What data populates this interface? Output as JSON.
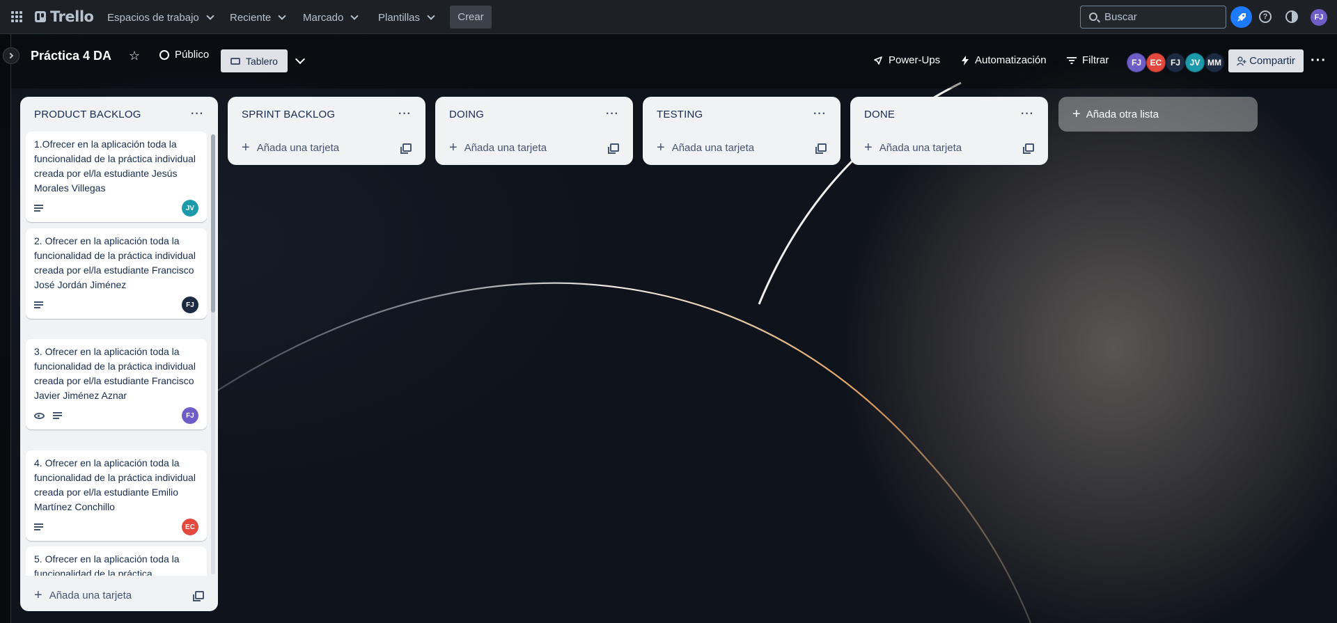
{
  "app": {
    "name": "Trello"
  },
  "nav": {
    "workspaces": "Espacios de trabajo",
    "recent": "Reciente",
    "starred": "Marcado",
    "templates": "Plantillas",
    "create": "Crear",
    "search_placeholder": "Buscar",
    "user_initials": "FJ"
  },
  "board": {
    "title": "Práctica 4 DA",
    "visibility": "Público",
    "view": "Tablero",
    "powerups": "Power-Ups",
    "automation": "Automatización",
    "filter": "Filtrar",
    "share": "Compartir",
    "members": [
      {
        "initials": "FJ",
        "color": "#6e5dc6"
      },
      {
        "initials": "EC",
        "color": "#e2483d"
      },
      {
        "initials": "FJ",
        "color": "#1c2b41"
      },
      {
        "initials": "JV",
        "color": "#1d9aaa"
      },
      {
        "initials": "MM",
        "color": "#1c2b41"
      }
    ]
  },
  "lists": [
    {
      "title": "PRODUCT BACKLOG",
      "add_card": "Añada una tarjeta",
      "cards": [
        {
          "text": "1.Ofrecer en la aplicación toda la funcionalidad de la práctica individual creada por el/la estudiante Jesús Morales Villegas",
          "member": "JV",
          "member_color": "#1d9aaa",
          "watch": false
        },
        {
          "text": "2. Ofrecer en la aplicación toda la funcionalidad de la práctica individual creada por el/la estudiante Francisco José Jordán Jiménez",
          "member": "FJ",
          "member_color": "#1c2b41",
          "watch": false
        },
        {
          "text": "3. Ofrecer en la aplicación toda la funcionalidad de la práctica individual creada por el/la estudiante Francisco Javier Jiménez Aznar",
          "member": "FJ",
          "member_color": "#6e5dc6",
          "watch": true
        },
        {
          "text": "4. Ofrecer en la aplicación toda la funcionalidad de la práctica individual creada por el/la estudiante Emilio Martínez Conchillo",
          "member": "EC",
          "member_color": "#e2483d",
          "watch": false
        },
        {
          "text": "5. Ofrecer en la aplicación toda la funcionalidad de la práctica",
          "member": "",
          "member_color": "",
          "watch": false
        }
      ]
    },
    {
      "title": "SPRINT BACKLOG",
      "add_card": "Añada una tarjeta",
      "cards": []
    },
    {
      "title": "DOING",
      "add_card": "Añada una tarjeta",
      "cards": []
    },
    {
      "title": "TESTING",
      "add_card": "Añada una tarjeta",
      "cards": []
    },
    {
      "title": "DONE",
      "add_card": "Añada una tarjeta",
      "cards": []
    }
  ],
  "add_list": "Añada otra lista"
}
